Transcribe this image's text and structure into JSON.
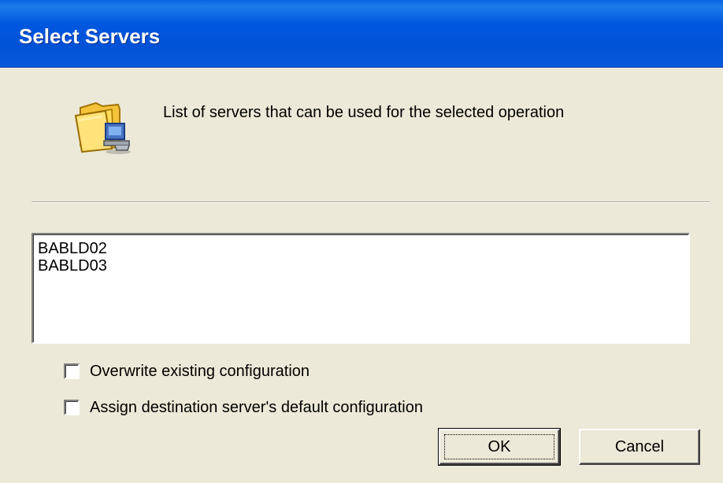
{
  "window": {
    "title": "Select Servers"
  },
  "header": {
    "description": "List of servers that can be used for the selected operation",
    "icon": "folder-computer-icon"
  },
  "server_list": {
    "items": [
      "BABLD02",
      "BABLD03"
    ]
  },
  "options": [
    {
      "label": "Overwrite existing configuration",
      "checked": false
    },
    {
      "label": "Assign destination server's default configuration",
      "checked": false
    }
  ],
  "buttons": {
    "ok_label": "OK",
    "cancel_label": "Cancel"
  },
  "colors": {
    "titlebar": "#0058df",
    "dialog_background": "#ece9d8"
  }
}
